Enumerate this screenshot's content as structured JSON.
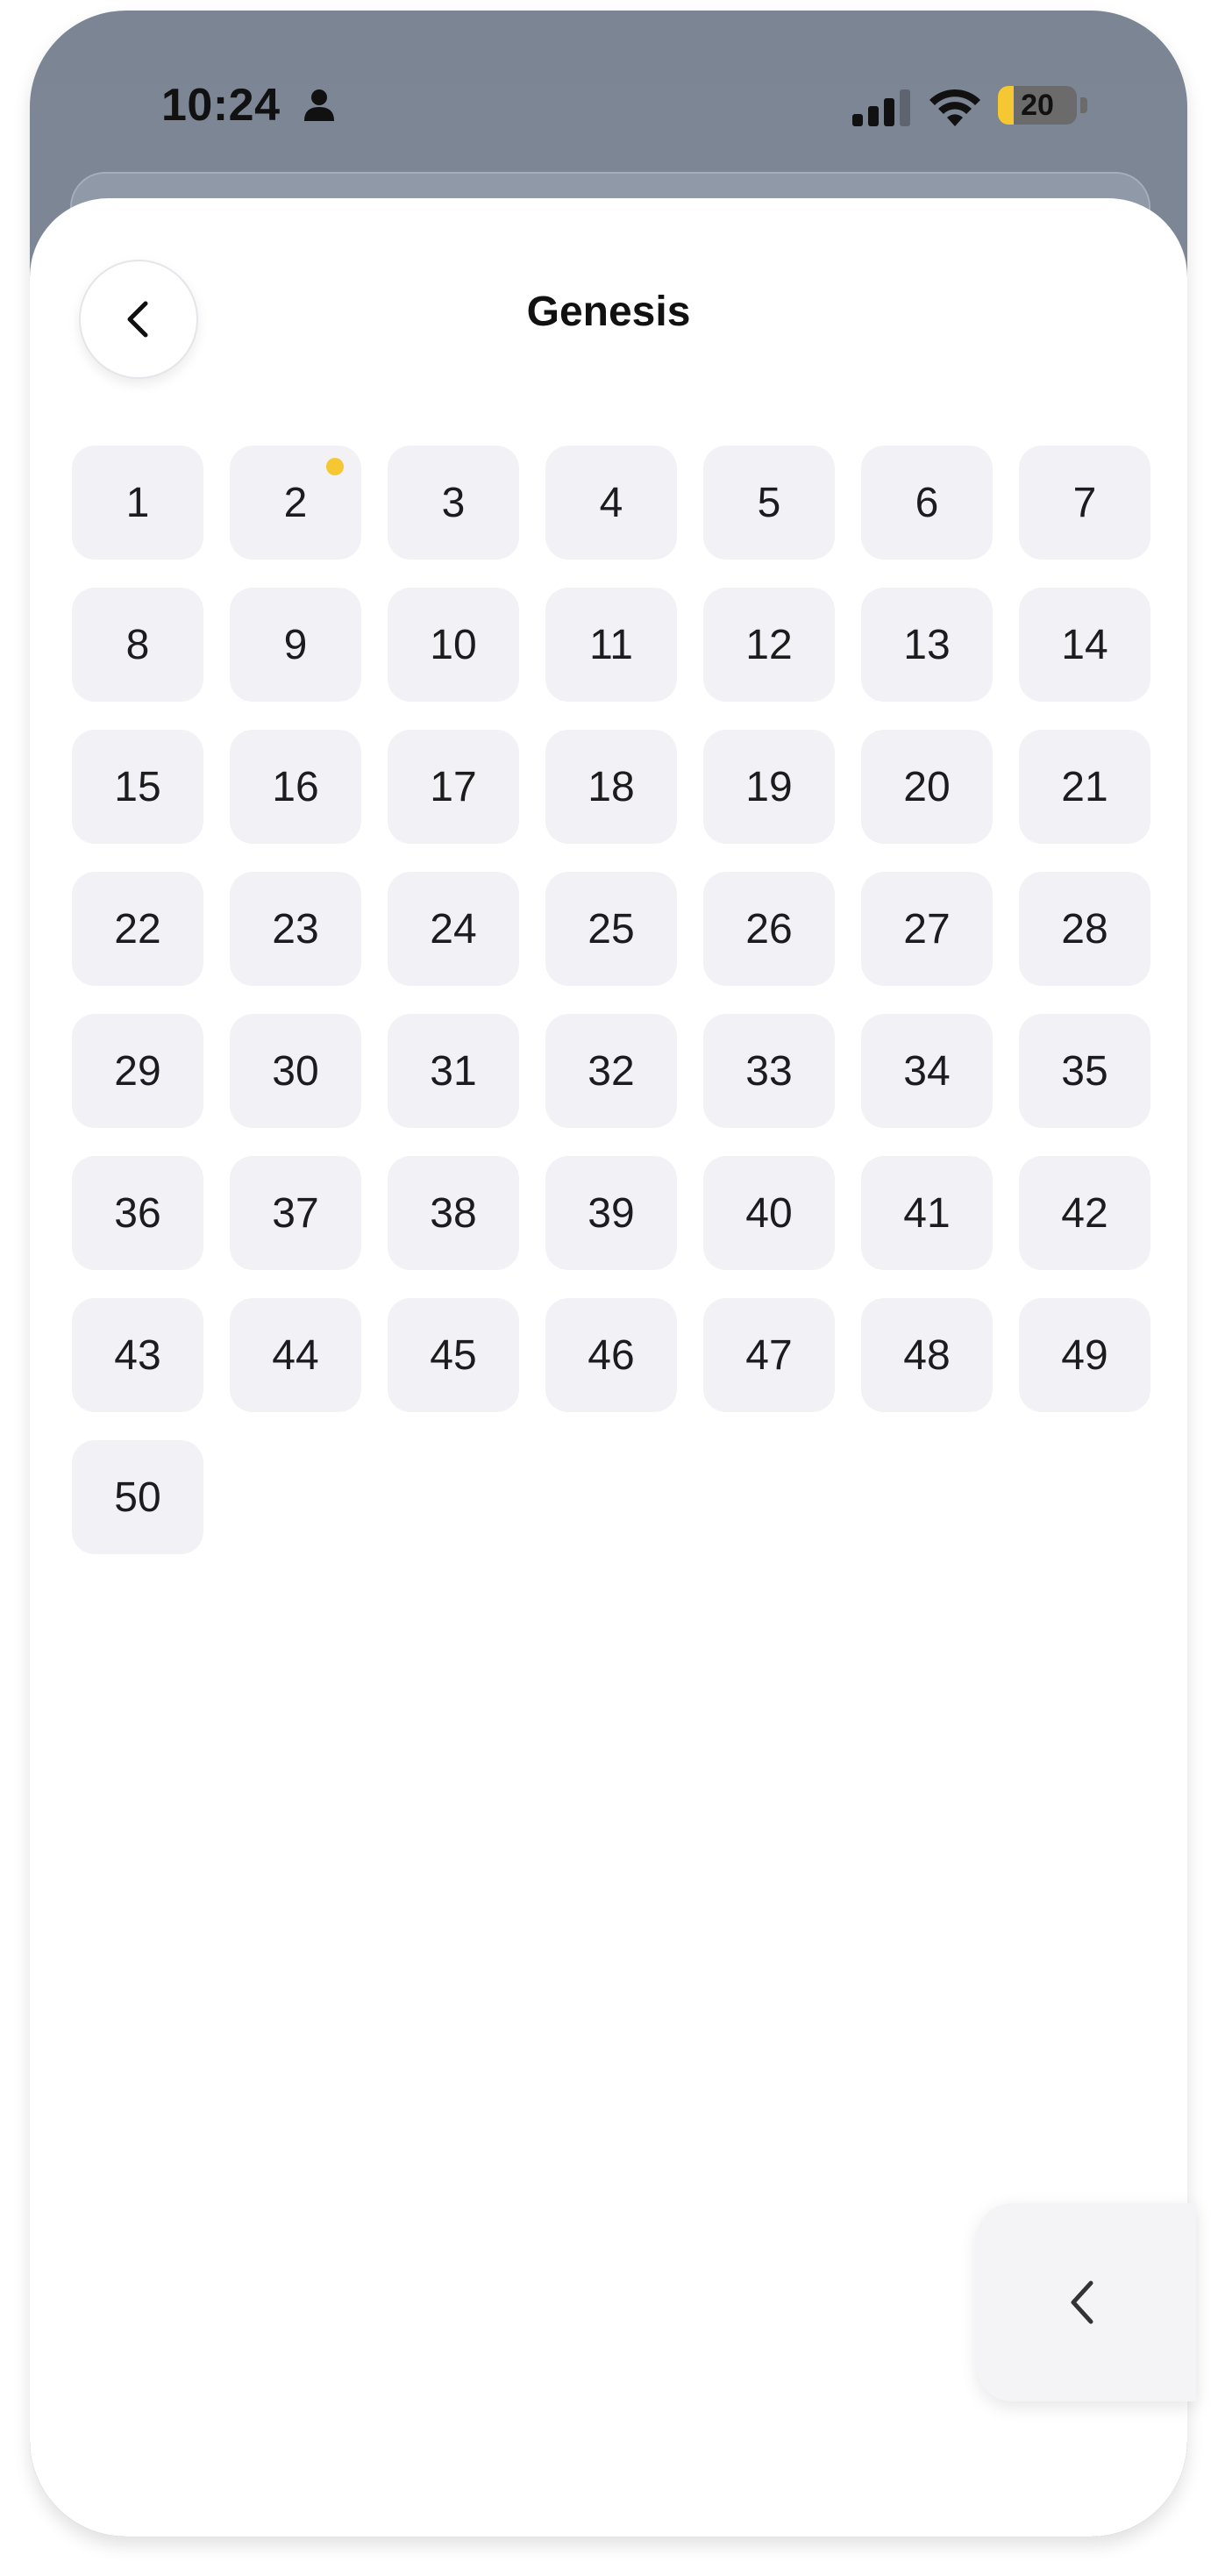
{
  "status_bar": {
    "time": "10:24",
    "battery_level": "20",
    "battery_fraction": 0.2,
    "icons": [
      "person-icon",
      "signal-icon",
      "wifi-icon",
      "battery-icon"
    ]
  },
  "header": {
    "title": "Genesis",
    "back_icon": "chevron-left-icon"
  },
  "chapters": {
    "items": [
      "1",
      "2",
      "3",
      "4",
      "5",
      "6",
      "7",
      "8",
      "9",
      "10",
      "11",
      "12",
      "13",
      "14",
      "15",
      "16",
      "17",
      "18",
      "19",
      "20",
      "21",
      "22",
      "23",
      "24",
      "25",
      "26",
      "27",
      "28",
      "29",
      "30",
      "31",
      "32",
      "33",
      "34",
      "35",
      "36",
      "37",
      "38",
      "39",
      "40",
      "41",
      "42",
      "43",
      "44",
      "45",
      "46",
      "47",
      "48",
      "49",
      "50"
    ],
    "marked": [
      "2"
    ],
    "marker_color": "#f5c833"
  },
  "floating_tab": {
    "icon": "chevron-left-icon"
  },
  "colors": {
    "accent": "#f5c833",
    "tile_background": "#f2f2f6"
  }
}
